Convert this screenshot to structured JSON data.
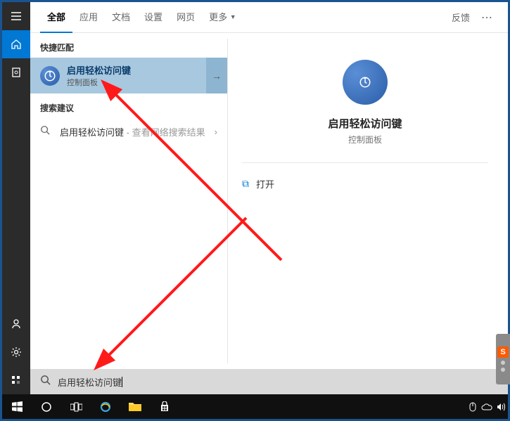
{
  "tabs": {
    "all": "全部",
    "apps": "应用",
    "docs": "文档",
    "settings": "设置",
    "web": "网页",
    "more": "更多",
    "feedback": "反馈"
  },
  "sections": {
    "best_match": "快捷匹配",
    "suggestions": "搜索建议"
  },
  "best_match": {
    "title": "启用轻松访问键",
    "subtitle": "控制面板"
  },
  "suggestion": {
    "main": "启用轻松访问键",
    "extra": " - 查看网络搜索结果"
  },
  "preview": {
    "title": "启用轻松访问键",
    "subtitle": "控制面板",
    "open_label": "打开"
  },
  "search": {
    "value": "启用轻松访问键"
  }
}
